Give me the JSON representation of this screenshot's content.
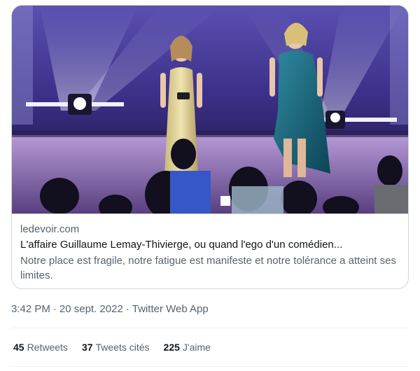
{
  "link_card": {
    "image_alt": "Stage photo of two hosts at an awards gala",
    "domain": "ledevoir.com",
    "title": "L'affaire Guillaume Lemay-Thivierge, ou quand l'ego d'un comédien...",
    "description": "Notre place est fragile, notre fatigue est manifeste et notre tolérance a atteint ses limites."
  },
  "tweet_meta": {
    "time": "3:42 PM",
    "separator": "·",
    "date": "20 sept. 2022",
    "source": "Twitter Web App"
  },
  "stats": {
    "retweets_count": "45",
    "retweets_label": "Retweets",
    "quotes_count": "37",
    "quotes_label": "Tweets cités",
    "likes_count": "225",
    "likes_label": "J'aime"
  }
}
